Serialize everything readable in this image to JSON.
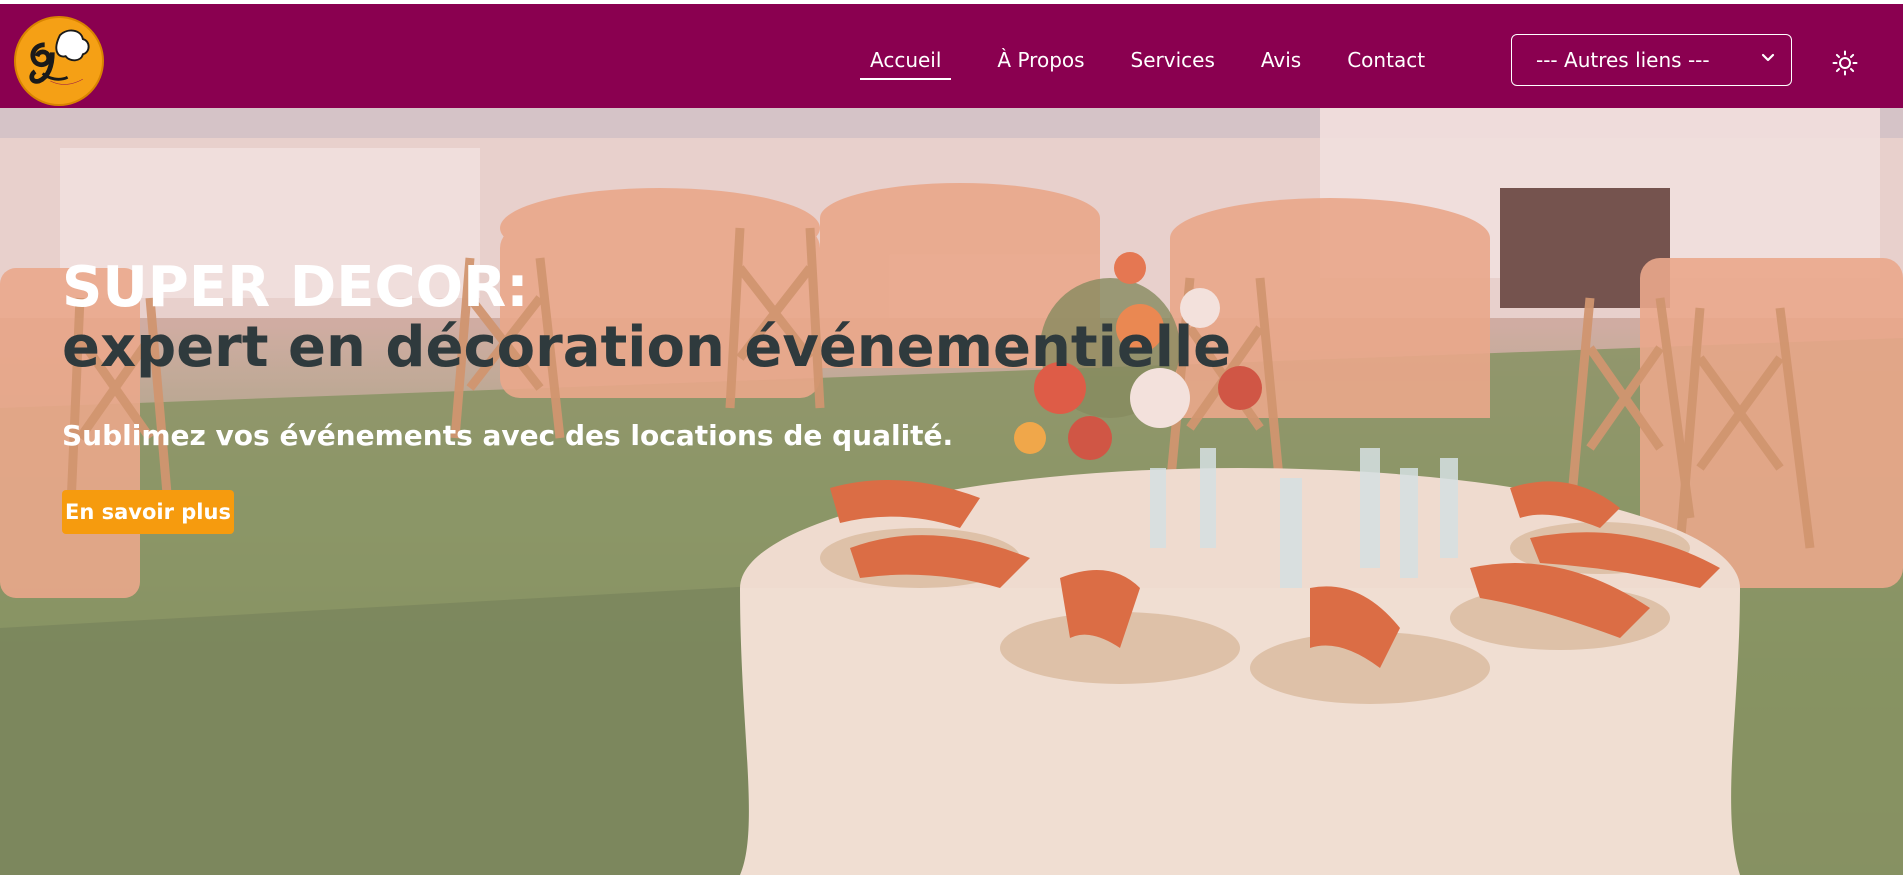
{
  "brand": {
    "logo_name": "Super Decor logo",
    "logo_text": "SUPER DECOR"
  },
  "nav": {
    "items": [
      {
        "label": "Accueil",
        "active": true
      },
      {
        "label": "À Propos"
      },
      {
        "label": "Services"
      },
      {
        "label": "Avis"
      },
      {
        "label": "Contact"
      }
    ],
    "select_value": "--- Autres liens ---",
    "theme_icon": "sun-icon"
  },
  "hero": {
    "title_line1": "SUPER DECOR:",
    "title_line2": "expert en décoration événementielle",
    "subtitle": "Sublimez vos événements avec des locations de qualité.",
    "cta_label": "En savoir plus"
  },
  "colors": {
    "header_bg": "#8a0050",
    "cta_bg": "#f69b0e",
    "title_dark": "#2f3a3d",
    "logo_orange": "#f5a015"
  }
}
